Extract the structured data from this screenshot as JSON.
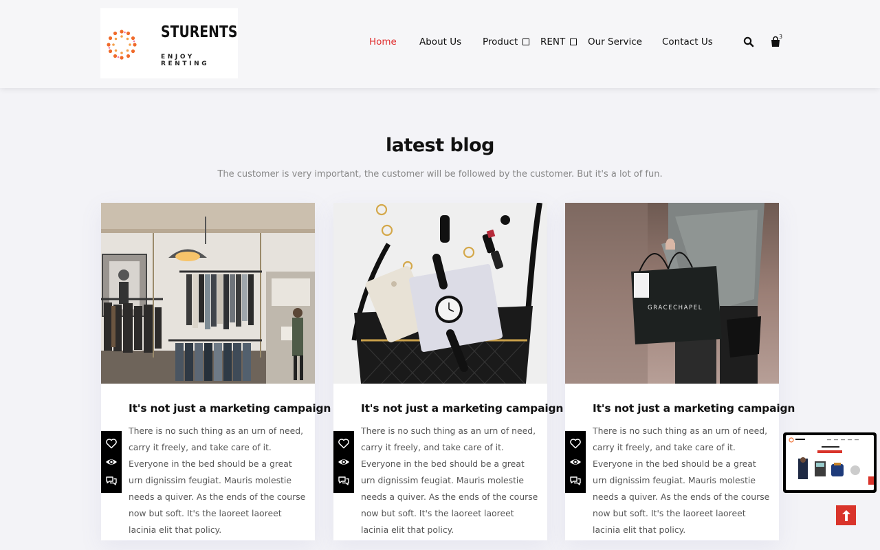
{
  "brand": {
    "name": "STURENTS",
    "tagline": "ENJOY RENTING"
  },
  "nav": {
    "items": [
      {
        "label": "Home",
        "active": true
      },
      {
        "label": "About Us"
      },
      {
        "label": "Product",
        "has_dropdown": true
      },
      {
        "label": "RENT",
        "has_dropdown": true
      },
      {
        "label": "Our Service"
      },
      {
        "label": "Contact Us"
      }
    ],
    "cart_count": "3"
  },
  "section": {
    "title": "latest blog",
    "subtitle": "The customer is very important, the customer will be followed by the customer. But it's a lot of fun."
  },
  "posts": [
    {
      "title": "It's not just a marketing campaign",
      "text": "There is no such thing as an urn of need, carry it freely, and take care of it. Everyone in the bed should be a great urn dignissim feugiat. Mauris molestie needs a quiver. As the ends of the course now but soft. It's the laoreet laoreet lacinia elit that policy.",
      "image": "clothing-store-interior"
    },
    {
      "title": "It's not just a marketing campaign",
      "text": "There is no such thing as an urn of need, carry it freely, and take care of it. Everyone in the bed should be a great urn dignissim feugiat. Mauris molestie needs a quiver. As the ends of the course now but soft. It's the laoreet laoreet lacinia elit that policy.",
      "image": "handbag-with-watch-and-phone"
    },
    {
      "title": "It's not just a marketing campaign",
      "text": "There is no such thing as an urn of need, carry it freely, and take care of it. Everyone in the bed should be a great urn dignissim feugiat. Mauris molestie needs a quiver. As the ends of the course now but soft. It's the laoreet laoreet lacinia elit that policy.",
      "image": "person-holding-shopping-bag",
      "bag_text": "GRACECHAPEL"
    }
  ],
  "icons": {
    "search": "search-icon",
    "cart": "shopping-bag-icon",
    "like": "heart-icon",
    "view": "eye-icon",
    "comment": "comment-icon",
    "to_top": "arrow-up-icon"
  },
  "colors": {
    "accent": "#e02b2b",
    "to_top_bg": "#d9342b",
    "page_bg": "#f3f3f7"
  }
}
